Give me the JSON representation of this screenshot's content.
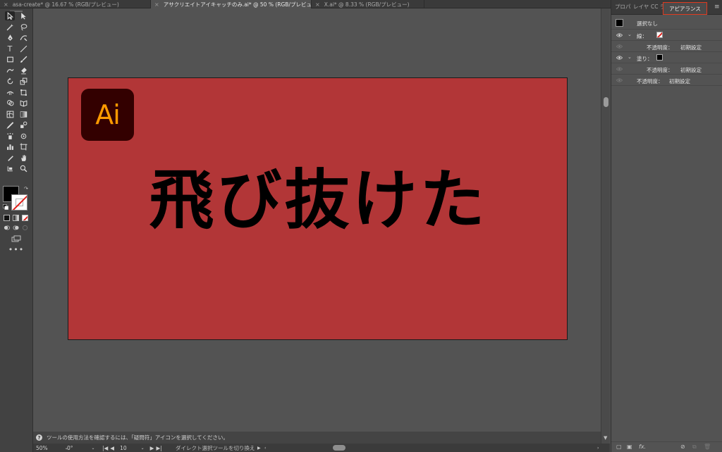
{
  "tabs": [
    {
      "label": "asa-create* @ 16.67 % (RGB/プレビュー)"
    },
    {
      "label": "アサクリエイトアイキャッチのみ.ai* @ 50 % (RGB/プレビュー)"
    },
    {
      "label": "X.ai* @ 8.33 % (RGB/プレビュー)"
    }
  ],
  "artboard": {
    "logo_text": "Ai",
    "headline": "飛び抜けた",
    "background_color": "#b23637",
    "logo_bg": "#330000",
    "logo_fg": "#ff9a00"
  },
  "status": {
    "help_text": "ツールの使用方法を確認するには、「疑問符」アイコンを選択してください。"
  },
  "bottom": {
    "zoom": "50%",
    "rotation": "0°",
    "artboard_number": "10",
    "tool_hint": "ダイレクト選択ツールを切り換え"
  },
  "panel": {
    "tabs": [
      "プロパ",
      "レイヤ",
      "CC ラ"
    ],
    "active_tab": "アピアランス",
    "selection": "選択なし",
    "stroke_label": "線：",
    "fill_label": "塗り：",
    "opacity_label": "不透明度：",
    "opacity_value": "初期設定"
  },
  "icons": [
    "selection-tool-icon",
    "direct-selection-tool-icon",
    "magic-wand-icon",
    "lasso-icon",
    "pen-icon",
    "curvature-icon",
    "type-icon",
    "line-icon",
    "rectangle-icon",
    "paintbrush-icon",
    "shaper-icon",
    "eraser-icon",
    "rotate-icon",
    "scale-icon",
    "width-icon",
    "free-transform-icon",
    "shape-builder-icon",
    "perspective-icon",
    "mesh-icon",
    "gradient-icon",
    "eyedropper-icon",
    "blend-icon",
    "symbol-sprayer-icon",
    "column-graph-icon",
    "artboard-icon",
    "slice-icon",
    "hand-icon",
    "zoom-icon",
    "eye-icon",
    "menu-icon"
  ],
  "colors": {
    "accent_highlight": "#e03a1f",
    "stroke_none": "#e0201b"
  }
}
